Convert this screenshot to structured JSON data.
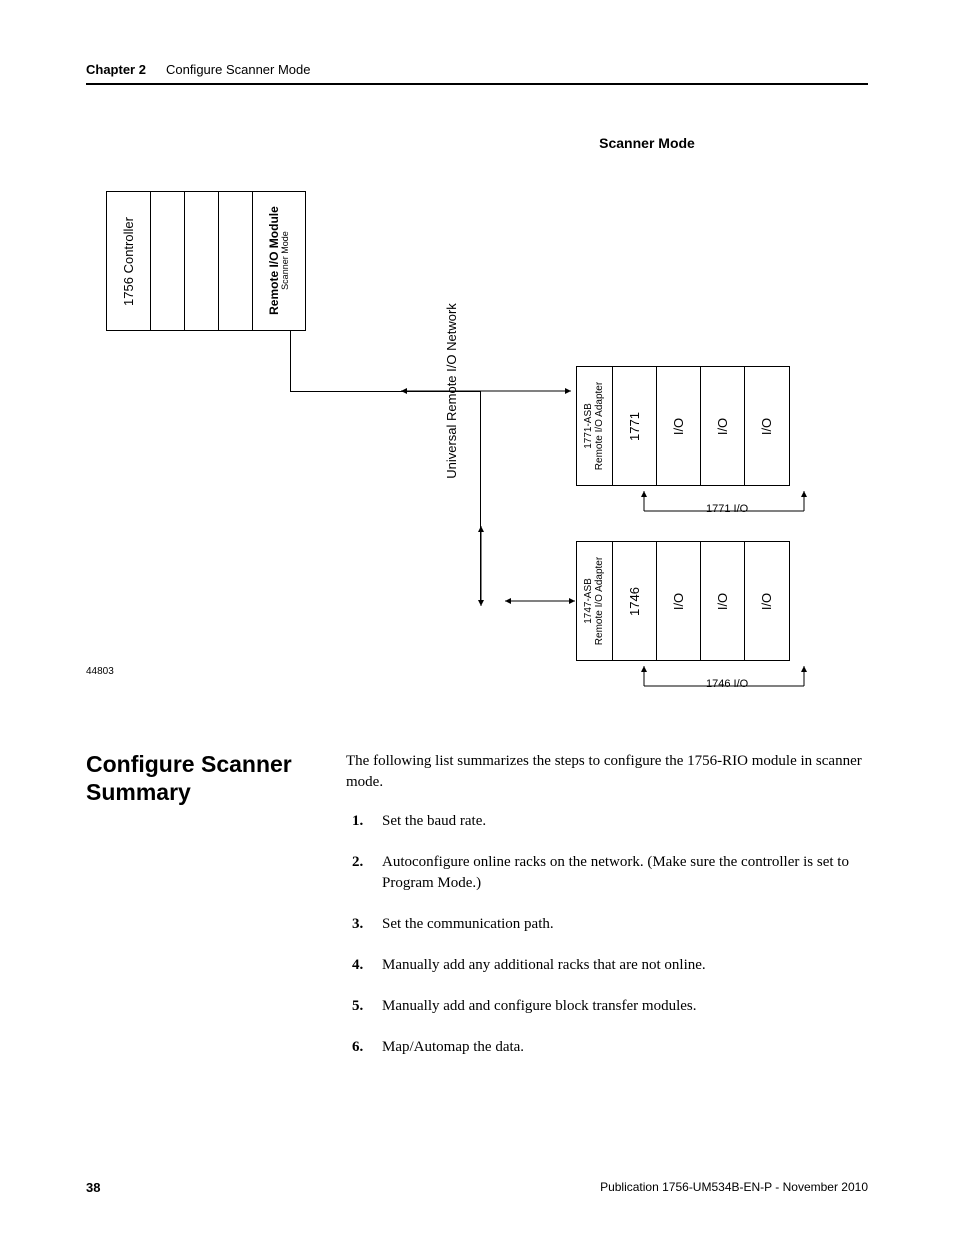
{
  "header": {
    "chapter": "Chapter 2",
    "title": "Configure Scanner Mode"
  },
  "diagram": {
    "title": "Scanner Mode",
    "figure_id": "44803",
    "top_chassis": {
      "controller": "1756 Controller",
      "rio_module": "Remote I/O Module",
      "rio_mode": "Scanner Mode"
    },
    "network_label": "Universal Remote I/O Network",
    "rack1": {
      "adapter_model": "1771-ASB",
      "adapter_type": "Remote I/O Adapter",
      "module": "1771",
      "io": "I/O",
      "footer_label": "1771 I/O"
    },
    "rack2": {
      "adapter_model": "1747-ASB",
      "adapter_type": "Remote I/O Adapter",
      "module": "1746",
      "io": "I/O",
      "footer_label": "1746 I/O"
    }
  },
  "section": {
    "heading": "Configure Scanner Summary",
    "intro": "The following list summarizes the steps to configure the 1756-RIO module in scanner mode.",
    "steps": [
      "Set the baud rate.",
      "Autoconfigure online racks on the network. (Make sure the controller is set to Program Mode.)",
      "Set the communication path.",
      "Manually add any additional racks that are not online.",
      "Manually add and configure block transfer modules.",
      "Map/Automap the data."
    ]
  },
  "footer": {
    "page": "38",
    "publication": "Publication 1756-UM534B-EN-P - November 2010"
  }
}
